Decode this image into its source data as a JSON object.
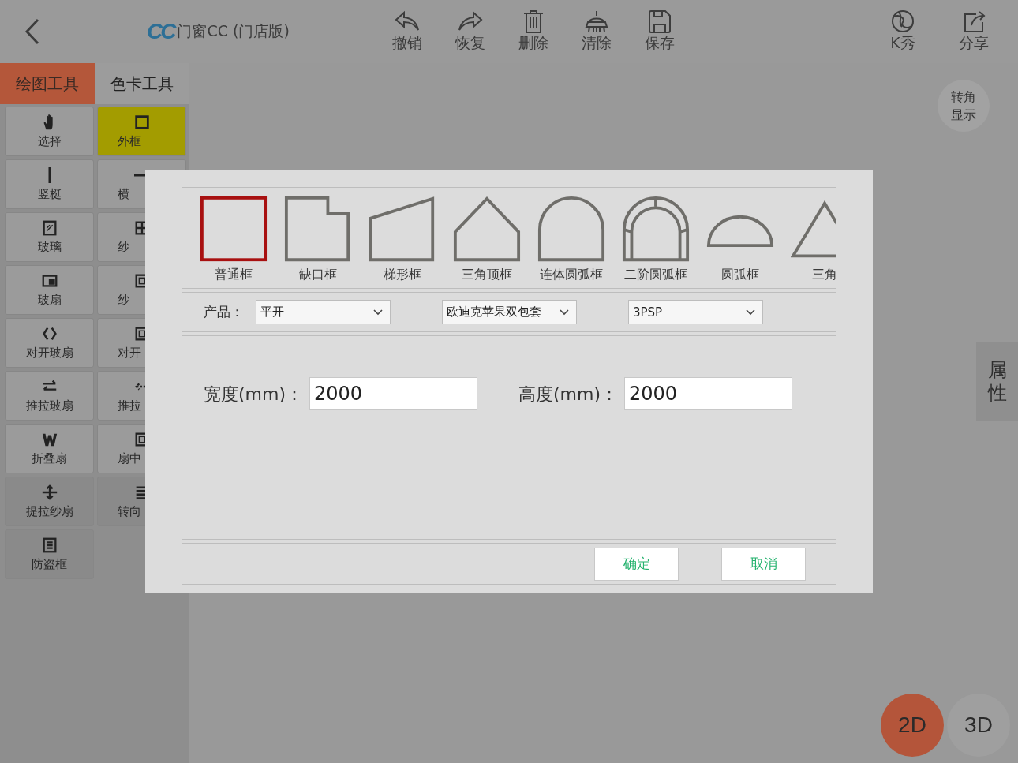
{
  "header": {
    "logo_text": "CC",
    "title": "门窗CC (门店版)",
    "tools": [
      {
        "label": "撤销"
      },
      {
        "label": "恢复"
      },
      {
        "label": "删除"
      },
      {
        "label": "清除"
      },
      {
        "label": "保存"
      }
    ],
    "right_tools": [
      {
        "label": "K秀"
      },
      {
        "label": "分享"
      }
    ]
  },
  "sidebar": {
    "tabs": [
      {
        "label": "绘图工具",
        "selected": true
      },
      {
        "label": "色卡工具",
        "selected": false
      }
    ],
    "tools": [
      {
        "label": "选择",
        "selected": false,
        "disabled": false
      },
      {
        "label": "外框",
        "selected": true,
        "disabled": false
      },
      {
        "label": "竖梃",
        "selected": false,
        "disabled": false
      },
      {
        "label": "横",
        "selected": false,
        "disabled": false
      },
      {
        "label": "玻璃",
        "selected": false,
        "disabled": false
      },
      {
        "label": "纱",
        "selected": false,
        "disabled": false
      },
      {
        "label": "玻扇",
        "selected": false,
        "disabled": false
      },
      {
        "label": "纱",
        "selected": false,
        "disabled": false
      },
      {
        "label": "对开玻扇",
        "selected": false,
        "disabled": false
      },
      {
        "label": "对开",
        "selected": false,
        "disabled": false
      },
      {
        "label": "推拉玻扇",
        "selected": false,
        "disabled": false
      },
      {
        "label": "推拉",
        "selected": false,
        "disabled": false
      },
      {
        "label": "折叠扇",
        "selected": false,
        "disabled": false
      },
      {
        "label": "扇中",
        "selected": false,
        "disabled": false
      },
      {
        "label": "提拉纱扇",
        "selected": false,
        "disabled": true
      },
      {
        "label": "转向",
        "selected": false,
        "disabled": true
      },
      {
        "label": "防盗框",
        "selected": false,
        "disabled": true
      }
    ]
  },
  "canvas": {
    "corner_button": "转角显示",
    "properties_tab": "属性",
    "view_modes": [
      {
        "label": "2D",
        "selected": true
      },
      {
        "label": "3D",
        "selected": false
      }
    ]
  },
  "dialog": {
    "shapes": [
      {
        "label": "普通框",
        "kind": "square",
        "selected": true
      },
      {
        "label": "缺口框",
        "kind": "notch",
        "selected": false
      },
      {
        "label": "梯形框",
        "kind": "trapezoid",
        "selected": false
      },
      {
        "label": "三角顶框",
        "kind": "gable",
        "selected": false
      },
      {
        "label": "连体圆弧框",
        "kind": "arch",
        "selected": false
      },
      {
        "label": "二阶圆弧框",
        "kind": "double-arch",
        "selected": false
      },
      {
        "label": "圆弧框",
        "kind": "semicircle",
        "selected": false
      },
      {
        "label": "三角",
        "kind": "triangle",
        "selected": false
      }
    ],
    "product_label": "产品：",
    "selects": [
      {
        "value": "平开"
      },
      {
        "value": "欧迪克苹果双包套"
      },
      {
        "value": "3PSP"
      }
    ],
    "width": {
      "label": "宽度(mm)：",
      "value": "2000"
    },
    "height": {
      "label": "高度(mm)：",
      "value": "2000"
    },
    "buttons": [
      {
        "label": "确定"
      },
      {
        "label": "取消"
      }
    ]
  }
}
